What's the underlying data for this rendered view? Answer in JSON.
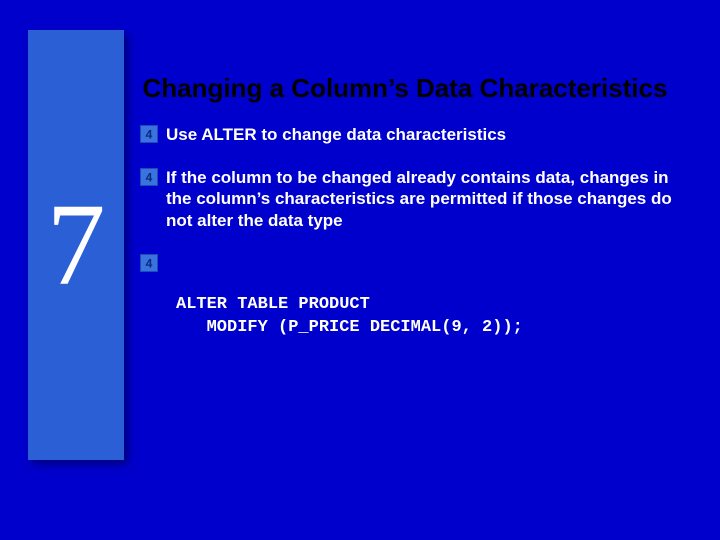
{
  "sidebar": {
    "chapter_number": "7"
  },
  "slide": {
    "title": "Changing a Column’s Data Characteristics",
    "bullets": [
      {
        "text": "Use ALTER to change data characteristics"
      },
      {
        "text": "If the column to be changed already contains data, changes in the column’s characteristics are permitted if those changes do not alter the data type"
      },
      {
        "text": ""
      }
    ],
    "code": "ALTER TABLE PRODUCT\n   MODIFY (P_PRICE DECIMAL(9, 2));"
  },
  "icons": {
    "bullet_square": "square-number-4-icon"
  }
}
